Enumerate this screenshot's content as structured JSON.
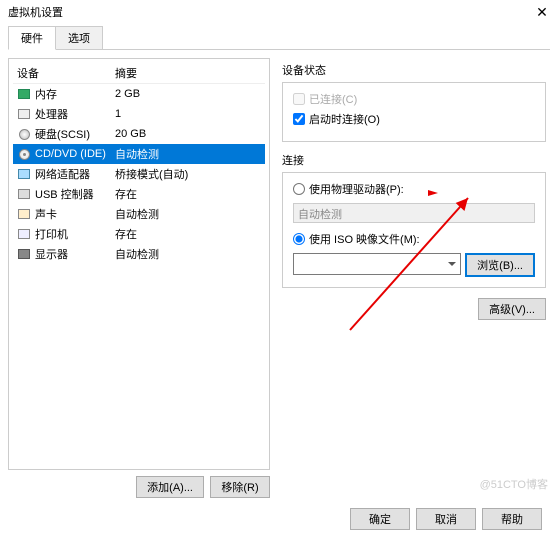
{
  "window": {
    "title": "虚拟机设置"
  },
  "tabs": {
    "hardware": "硬件",
    "options": "选项",
    "active": 0
  },
  "list": {
    "headers": {
      "device": "设备",
      "summary": "摘要"
    },
    "items": [
      {
        "icon": "mem",
        "name": "内存",
        "summary": "2 GB"
      },
      {
        "icon": "cpu",
        "name": "处理器",
        "summary": "1"
      },
      {
        "icon": "disk",
        "name": "硬盘(SCSI)",
        "summary": "20 GB"
      },
      {
        "icon": "cd",
        "name": "CD/DVD (IDE)",
        "summary": "自动检测",
        "selected": true
      },
      {
        "icon": "net",
        "name": "网络适配器",
        "summary": "桥接模式(自动)"
      },
      {
        "icon": "usb",
        "name": "USB 控制器",
        "summary": "存在"
      },
      {
        "icon": "snd",
        "name": "声卡",
        "summary": "自动检测"
      },
      {
        "icon": "prn",
        "name": "打印机",
        "summary": "存在"
      },
      {
        "icon": "dsp",
        "name": "显示器",
        "summary": "自动检测"
      }
    ]
  },
  "leftButtons": {
    "add": "添加(A)...",
    "remove": "移除(R)"
  },
  "status": {
    "group": "设备状态",
    "connected": "已连接(C)",
    "connectAtPowerOn": "启动时连接(O)"
  },
  "connection": {
    "group": "连接",
    "physical": "使用物理驱动器(P):",
    "physicalCombo": "自动检测",
    "iso": "使用 ISO 映像文件(M):",
    "isoValue": "",
    "browse": "浏览(B)..."
  },
  "advanced": "高级(V)...",
  "bottom": {
    "ok": "确定",
    "cancel": "取消",
    "help": "帮助"
  },
  "watermark": "@51CTO博客"
}
